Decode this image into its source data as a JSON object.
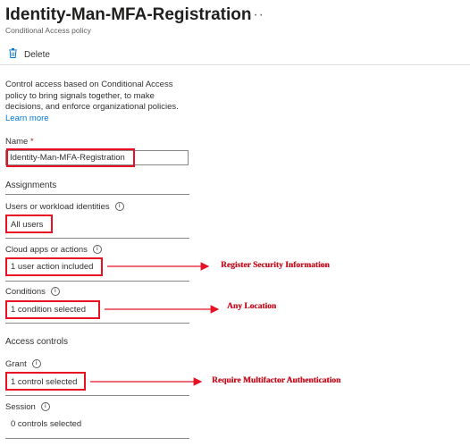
{
  "header": {
    "title": "Identity-Man-MFA-Registration",
    "more_label": "···",
    "subtitle": "Conditional Access policy"
  },
  "toolbar": {
    "delete_label": "Delete"
  },
  "description": {
    "text": "Control access based on Conditional Access policy to bring signals together, to make decisions, and enforce organizational policies.",
    "learn_more": "Learn more"
  },
  "name_field": {
    "label": "Name",
    "required_mark": "*",
    "value": "Identity-Man-MFA-Registration"
  },
  "assignments": {
    "heading": "Assignments",
    "users": {
      "label": "Users or workload identities",
      "value": "All users"
    },
    "cloud_apps": {
      "label": "Cloud apps or actions",
      "value": "1 user action included"
    },
    "conditions": {
      "label": "Conditions",
      "value": "1 condition selected"
    }
  },
  "access_controls": {
    "heading": "Access controls",
    "grant": {
      "label": "Grant",
      "value": "1 control selected"
    },
    "session": {
      "label": "Session",
      "value": "0 controls selected"
    }
  },
  "annotations": {
    "cloud_apps": "Register Security Information",
    "conditions": "Any Location",
    "grant": "Require Multifactor Authentication"
  },
  "colors": {
    "link": "#0078d4",
    "annotation_red": "#e81123"
  },
  "icons": {
    "delete": "trash-icon",
    "info": "info-icon"
  }
}
